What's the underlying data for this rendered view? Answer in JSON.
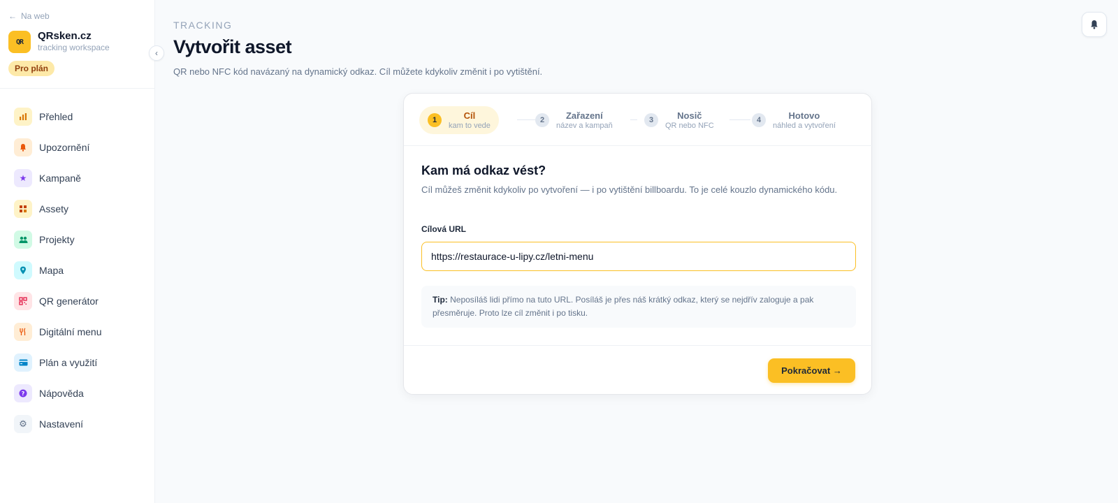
{
  "sidebar": {
    "back_label": "Na web",
    "brand": {
      "logo_text": "QR",
      "name": "QRsken.cz",
      "subtitle": "tracking workspace"
    },
    "plan_badge": "Pro plán",
    "collapse_glyph": "‹",
    "items": [
      {
        "label": "Přehled",
        "icon": "chart-icon",
        "glyph": "▮",
        "color": "#d97706",
        "bg": "#fef3c7"
      },
      {
        "label": "Upozornění",
        "icon": "bell-icon",
        "glyph": "●",
        "color": "#ea580c",
        "bg": "#ffedd5"
      },
      {
        "label": "Kampaně",
        "icon": "star-icon",
        "glyph": "★",
        "color": "#7c3aed",
        "bg": "#ede9fe"
      },
      {
        "label": "Assety",
        "icon": "grid-icon",
        "glyph": "▦",
        "color": "#c2410c",
        "bg": "#fef3c7"
      },
      {
        "label": "Projekty",
        "icon": "users-icon",
        "glyph": "●●",
        "color": "#059669",
        "bg": "#d1fae5"
      },
      {
        "label": "Mapa",
        "icon": "pin-icon",
        "glyph": "⚲",
        "color": "#0891b2",
        "bg": "#cffafe"
      },
      {
        "label": "QR generátor",
        "icon": "qr-icon",
        "glyph": "▣",
        "color": "#e11d48",
        "bg": "#ffe4e6"
      },
      {
        "label": "Digitální menu",
        "icon": "cutlery-icon",
        "glyph": "Ψ",
        "color": "#ea580c",
        "bg": "#ffedd5"
      },
      {
        "label": "Plán a využití",
        "icon": "card-icon",
        "glyph": "▬",
        "color": "#0284c7",
        "bg": "#e0f2fe"
      },
      {
        "label": "Nápověda",
        "icon": "help-icon",
        "glyph": "?",
        "color": "#ffffff",
        "bg": "#ede9fe"
      },
      {
        "label": "Nastavení",
        "icon": "gear-icon",
        "glyph": "⚙",
        "color": "#64748b",
        "bg": "#f1f5f9"
      }
    ]
  },
  "header": {
    "eyebrow": "TRACKING",
    "title": "Vytvořit asset",
    "subtitle": "QR nebo NFC kód navázaný na dynamický odkaz. Cíl můžete kdykoliv změnit i po vytištění."
  },
  "stepper": [
    {
      "num": "1",
      "label": "Cíl",
      "desc": "kam to vede",
      "active": true
    },
    {
      "num": "2",
      "label": "Zařazení",
      "desc": "název a kampaň",
      "active": false
    },
    {
      "num": "3",
      "label": "Nosič",
      "desc": "QR nebo NFC",
      "active": false
    },
    {
      "num": "4",
      "label": "Hotovo",
      "desc": "náhled a vytvoření",
      "active": false
    }
  ],
  "form": {
    "title": "Kam má odkaz vést?",
    "description": "Cíl můžeš změnit kdykoliv po vytvoření — i po vytištění billboardu. To je celé kouzlo dynamického kódu.",
    "url_label": "Cílová URL",
    "url_value": "https://restaurace-u-lipy.cz/letni-menu",
    "tip_strong": "Tip:",
    "tip_text": " Neposíláš lidi přímo na tuto URL. Posíláš je přes náš krátký odkaz, který se nejdřív zaloguje a pak přesměruje. Proto lze cíl změnit i po tisku.",
    "continue_label": "Pokračovat →"
  },
  "colors": {
    "accent": "#fbbf24",
    "accent_soft": "#fef6dc",
    "accent_text": "#b45309"
  }
}
